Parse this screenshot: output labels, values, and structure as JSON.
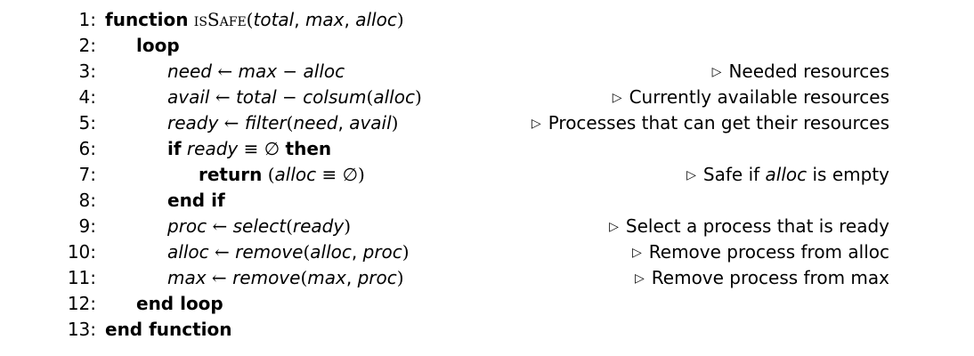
{
  "algorithm": {
    "lines": [
      {
        "num": "1:"
      },
      {
        "num": "2:"
      },
      {
        "num": "3:",
        "comment": "Needed resources"
      },
      {
        "num": "4:",
        "comment": "Currently available resources"
      },
      {
        "num": "5:",
        "comment": "Processes that can get their resources"
      },
      {
        "num": "6:"
      },
      {
        "num": "7:",
        "comment_pre": "Safe if ",
        "comment_var": "alloc",
        "comment_post": " is empty"
      },
      {
        "num": "8:"
      },
      {
        "num": "9:",
        "comment": "Select a process that is ready"
      },
      {
        "num": "10:",
        "comment": "Remove process from alloc"
      },
      {
        "num": "11:",
        "comment": "Remove process from max"
      },
      {
        "num": "12:"
      },
      {
        "num": "13:"
      }
    ],
    "tokens": {
      "function": "function",
      "func_name": "isSafe",
      "lparen": "(",
      "rparen": ")",
      "comma": ", ",
      "total": "total",
      "max": "max",
      "alloc": "alloc",
      "loop": "loop",
      "need": "need",
      "avail": "avail",
      "ready": "ready",
      "proc": "proc",
      "arrow": " ← ",
      "minus": " − ",
      "colsum": "colsum",
      "filter": "filter",
      "select": "select",
      "remove": "remove",
      "if": "if",
      "equiv": " ≡ ",
      "empty": "∅",
      "then": "then",
      "return": "return",
      "end_if": "end if",
      "end_loop": "end loop",
      "end_function": "end function",
      "comment_marker": "▷"
    }
  }
}
